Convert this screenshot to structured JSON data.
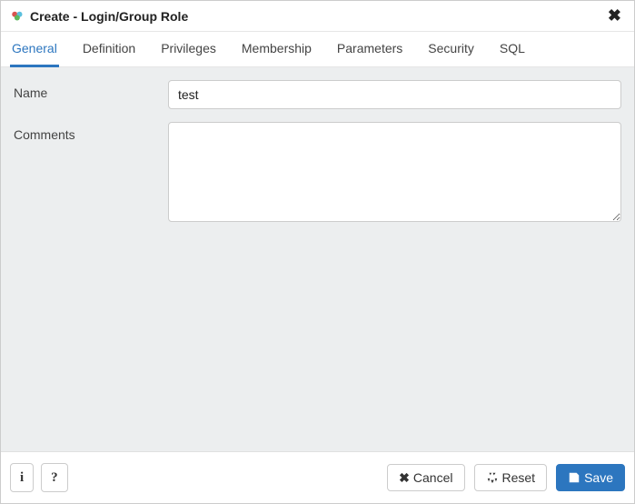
{
  "dialog": {
    "title": "Create - Login/Group Role"
  },
  "tabs": [
    {
      "label": "General",
      "active": true
    },
    {
      "label": "Definition",
      "active": false
    },
    {
      "label": "Privileges",
      "active": false
    },
    {
      "label": "Membership",
      "active": false
    },
    {
      "label": "Parameters",
      "active": false
    },
    {
      "label": "Security",
      "active": false
    },
    {
      "label": "SQL",
      "active": false
    }
  ],
  "form": {
    "name_label": "Name",
    "name_value": "test",
    "comments_label": "Comments",
    "comments_value": ""
  },
  "footer": {
    "cancel_label": "Cancel",
    "reset_label": "Reset",
    "save_label": "Save"
  }
}
